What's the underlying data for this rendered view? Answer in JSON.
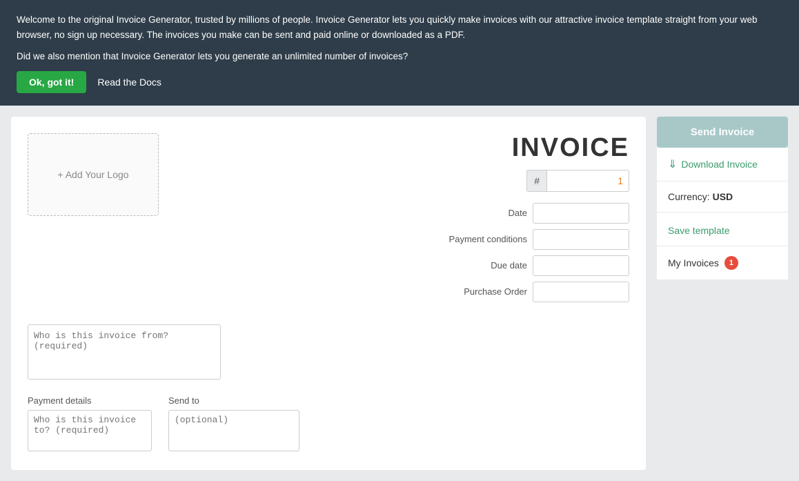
{
  "banner": {
    "line1": "Welcome to the original Invoice Generator, trusted by millions of people. Invoice Generator lets you quickly make invoices with our attractive invoice template straight from your web browser, no sign up necessary. The invoices you make can be sent and paid online or downloaded as a PDF.",
    "line2": "Did we also mention that Invoice Generator lets you generate an unlimited number of invoices?",
    "ok_label": "Ok, got it!",
    "docs_label": "Read the Docs"
  },
  "invoice": {
    "title": "INVOICE",
    "logo_placeholder": "+ Add Your Logo",
    "number_hash": "#",
    "number_value": "1",
    "from_placeholder": "Who is this invoice from? (required)",
    "date_label": "Date",
    "payment_conditions_label": "Payment conditions",
    "due_date_label": "Due date",
    "purchase_order_label": "Purchase Order",
    "payment_details_label": "Payment details",
    "send_to_label": "Send to",
    "payment_details_placeholder": "Who is this invoice to? (required)",
    "send_to_placeholder": "(optional)"
  },
  "sidebar": {
    "send_label": "Send Invoice",
    "download_label": "Download Invoice",
    "currency_label": "Currency:",
    "currency_value": "USD",
    "save_template_label": "Save template",
    "my_invoices_label": "My Invoices",
    "my_invoices_badge": "1"
  },
  "colors": {
    "banner_bg": "#2e3d49",
    "ok_btn": "#28a745",
    "send_btn": "#a8c8c8",
    "download_color": "#3a9c6e",
    "badge_color": "#e74c3c"
  }
}
